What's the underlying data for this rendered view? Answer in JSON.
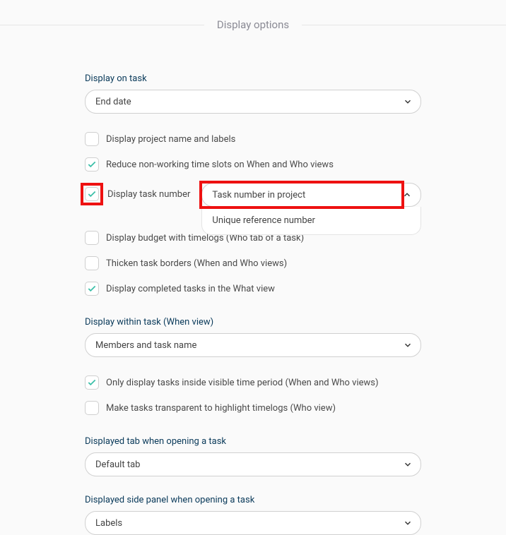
{
  "header": {
    "title": "Display options"
  },
  "displayOnTask": {
    "label": "Display on task",
    "value": "End date"
  },
  "cbProjectName": {
    "label": "Display project name and labels",
    "checked": false
  },
  "cbReduceNonWorking": {
    "label": "Reduce non-working time slots on When and Who views",
    "checked": true
  },
  "cbDisplayTaskNumber": {
    "label": "Display task number",
    "checked": true
  },
  "taskNumberDD": {
    "selected": "Task number in project",
    "option": "Unique reference number"
  },
  "cbBudgetTimelogs": {
    "label": "Display budget with timelogs (Who tab of a task)",
    "checked": false
  },
  "cbThickenBorders": {
    "label": "Thicken task borders (When and Who views)",
    "checked": false
  },
  "cbCompletedWhat": {
    "label": "Display completed tasks in the What view",
    "checked": true
  },
  "displayWithin": {
    "label": "Display within task (When view)",
    "value": "Members and task name"
  },
  "cbOnlyVisiblePeriod": {
    "label": "Only display tasks inside visible time period (When and Who views)",
    "checked": true
  },
  "cbTransparentTimelogs": {
    "label": "Make tasks transparent to highlight timelogs (Who view)",
    "checked": false
  },
  "displayedTab": {
    "label": "Displayed tab when opening a task",
    "value": "Default tab"
  },
  "displayedPanel": {
    "label": "Displayed side panel when opening a task",
    "value": "Labels"
  }
}
